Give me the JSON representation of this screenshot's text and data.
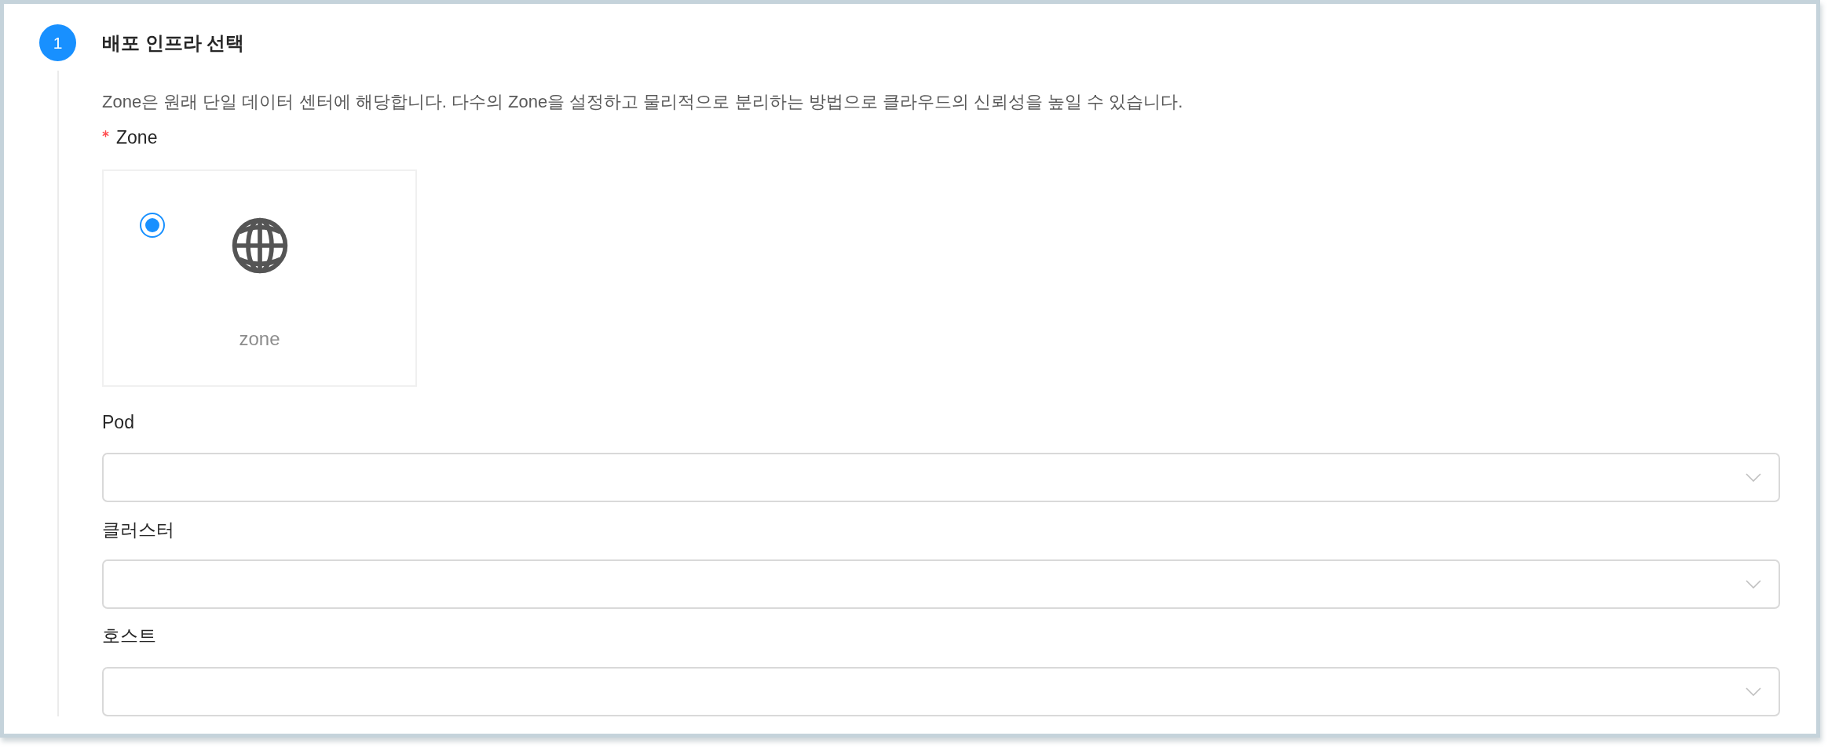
{
  "step": {
    "number": "1",
    "title": "배포 인프라 선택",
    "active": true
  },
  "description": "Zone은 원래 단일 데이터 센터에 해당합니다. 다수의 Zone을 설정하고 물리적으로 분리하는 방법으로 클라우드의 신뢰성을 높일 수 있습니다.",
  "zone": {
    "label": "Zone",
    "required": true,
    "options": [
      {
        "label": "zone",
        "selected": true
      }
    ]
  },
  "selects": [
    {
      "label": "Pod",
      "required": false
    },
    {
      "label": "클러스터",
      "required": false
    },
    {
      "label": "호스트",
      "required": false
    }
  ]
}
